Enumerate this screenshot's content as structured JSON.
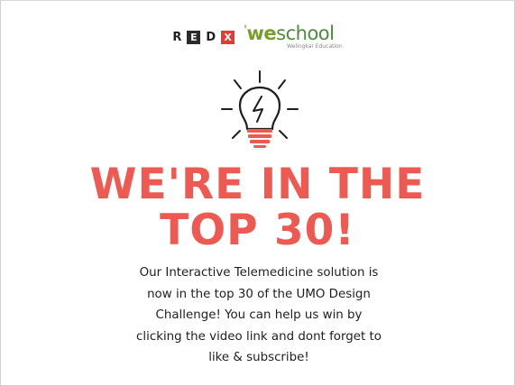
{
  "logos": {
    "redx": [
      "R",
      "E",
      "D",
      "X"
    ],
    "weschool_tick": "'",
    "weschool_we": "we",
    "weschool_school": "school",
    "weschool_sub": "Welingkar Education"
  },
  "headline": {
    "line1": "WE'RE IN THE",
    "line2": "TOP 30!"
  },
  "message": {
    "lines": [
      "Our Interactive Telemedicine solution is",
      "now in the top 30 of the UMO Design",
      "Challenge! You can help us win by",
      "clicking the video link and dont forget to",
      "like & subscribe!"
    ]
  },
  "colors": {
    "accent": "#ee5a52",
    "logo_red": "#e53935",
    "logo_green": "#4a8d3a",
    "text": "#1e1e1e"
  },
  "icons": {
    "bulb": "lightbulb-icon"
  }
}
